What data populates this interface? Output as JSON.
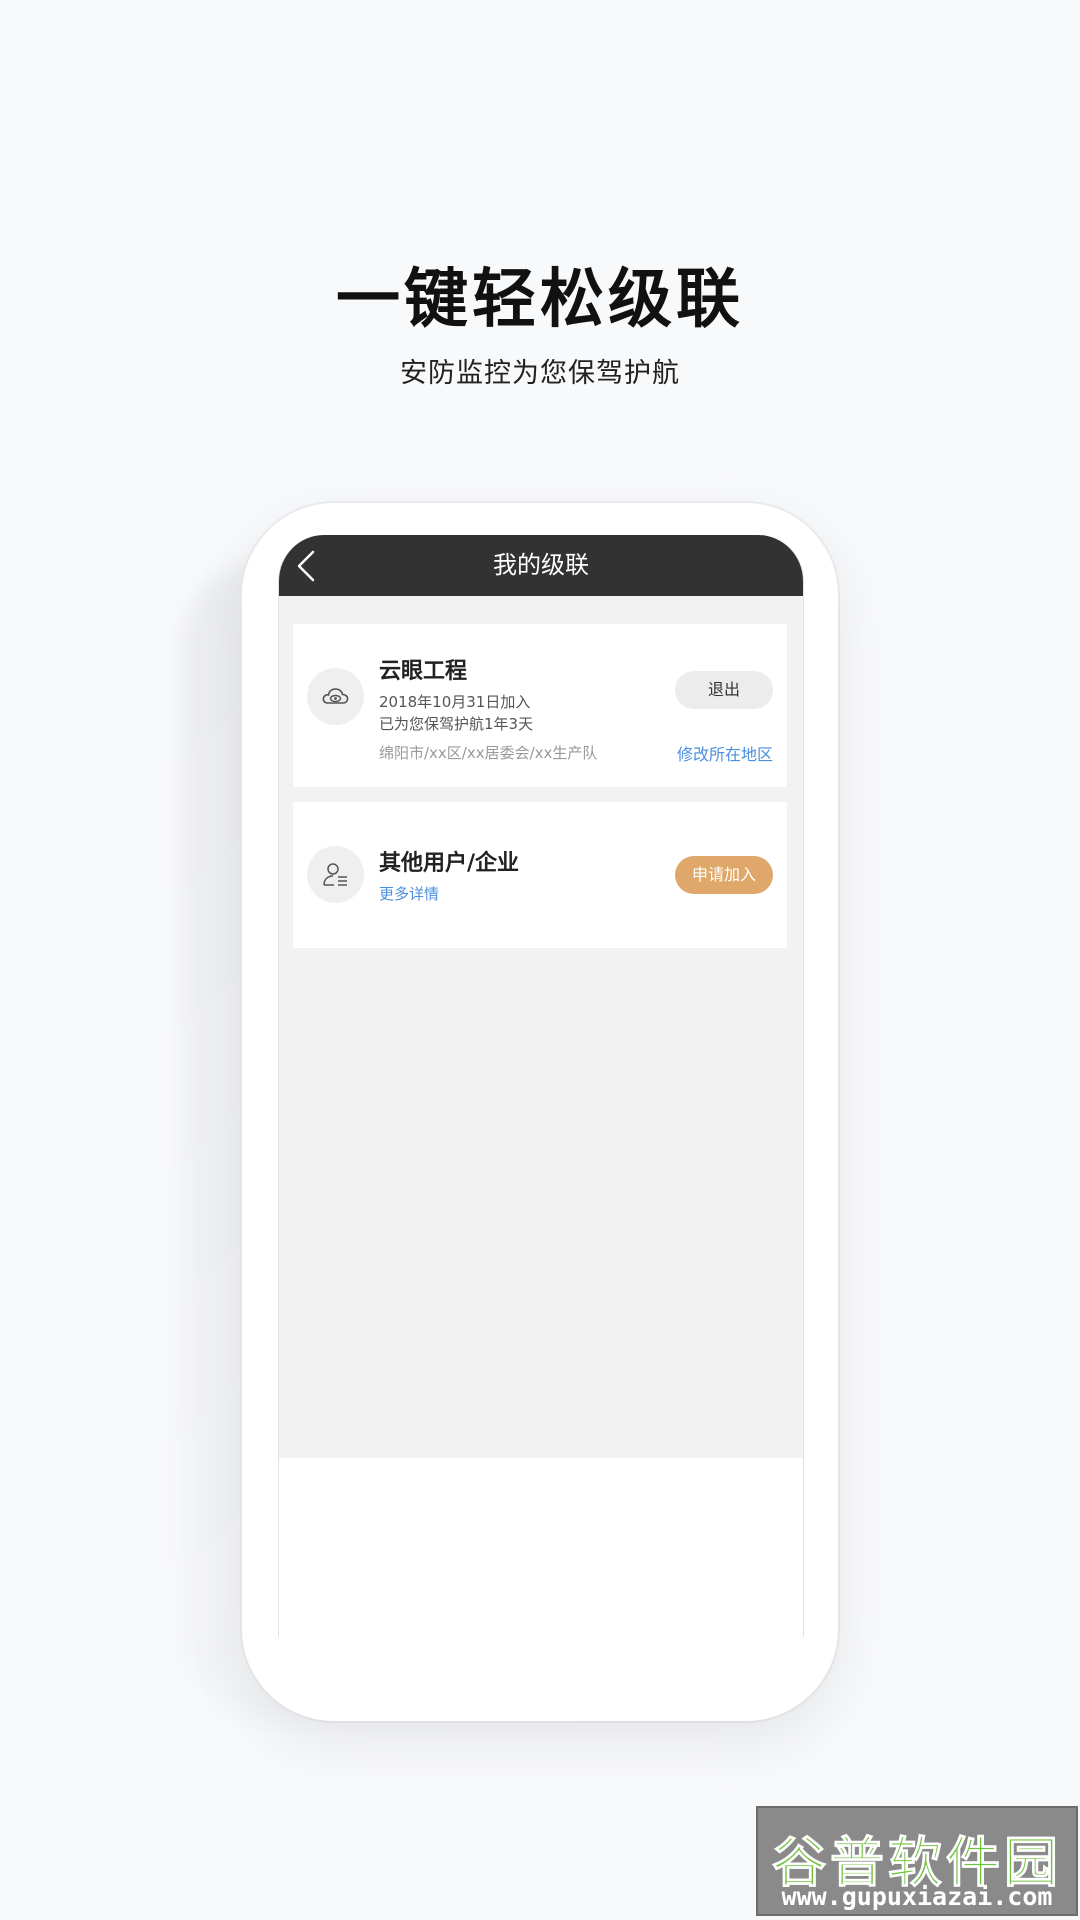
{
  "promo": {
    "title": "一键轻松级联",
    "subtitle": "安防监控为您保驾护航"
  },
  "nav": {
    "title": "我的级联",
    "back_icon": "chevron-left-icon"
  },
  "cards": [
    {
      "icon": "cloud-eye-icon",
      "title": "云眼工程",
      "join_date": "2018年10月31日加入",
      "protected_days": "已为您保驾护航1年3天",
      "address": "绵阳市/xx区/xx居委会/xx生产队",
      "action_label": "退出",
      "link_label": "修改所在地区"
    },
    {
      "icon": "user-detail-icon",
      "title": "其他用户/企业",
      "link_label": "更多详情",
      "action_label": "申请加入"
    }
  ],
  "watermark": {
    "logo": "谷普软件园",
    "url": "www.gupuxiazai.com"
  },
  "colors": {
    "nav_bg": "#323232",
    "content_bg": "#f2f2f2",
    "link": "#4a8fe0",
    "join_button": "#dfa86a"
  }
}
